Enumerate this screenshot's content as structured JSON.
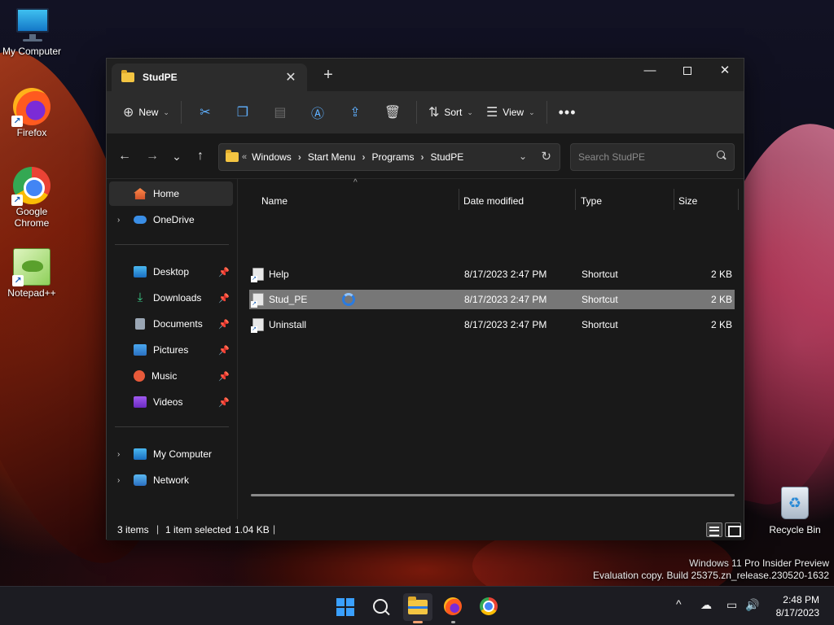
{
  "desktop": {
    "icons": [
      {
        "label": "My Computer",
        "icon": "monitor-icon"
      },
      {
        "label": "Firefox",
        "icon": "firefox-icon"
      },
      {
        "label": "Google Chrome",
        "icon": "chrome-icon"
      },
      {
        "label": "Notepad++",
        "icon": "notepadpp-icon"
      },
      {
        "label": "Recycle Bin",
        "icon": "recycle-bin-icon"
      }
    ],
    "watermark": {
      "line1": "Windows 11 Pro Insider Preview",
      "line2": "Evaluation copy. Build 25375.zn_release.230520-1632"
    }
  },
  "window": {
    "tab_title": "StudPE",
    "tab_close": "✕",
    "new_tab": "+",
    "controls": {
      "minimize": "—",
      "close": "✕"
    },
    "toolbar": {
      "new_label": "New",
      "sort_label": "Sort",
      "view_label": "View",
      "more": "•••",
      "icons": [
        "cut-icon",
        "copy-icon",
        "paste-icon",
        "rename-icon",
        "share-icon",
        "delete-icon"
      ]
    },
    "nav": {
      "back": "←",
      "forward": "→",
      "recent": "⌄",
      "up": "↑",
      "overflow": "«",
      "breadcrumbs": [
        "Windows",
        "Start Menu",
        "Programs",
        "StudPE"
      ],
      "search_placeholder": "Search StudPE"
    },
    "sidebar": {
      "items": [
        {
          "label": "Home",
          "icon": "home-icon",
          "selected": true
        },
        {
          "label": "OneDrive",
          "icon": "onedrive-icon",
          "expandable": true
        },
        {
          "label": "Desktop",
          "icon": "desktop-icon",
          "pinned": true
        },
        {
          "label": "Downloads",
          "icon": "downloads-icon",
          "pinned": true
        },
        {
          "label": "Documents",
          "icon": "documents-icon",
          "pinned": true
        },
        {
          "label": "Pictures",
          "icon": "pictures-icon",
          "pinned": true
        },
        {
          "label": "Music",
          "icon": "music-icon",
          "pinned": true
        },
        {
          "label": "Videos",
          "icon": "videos-icon",
          "pinned": true
        },
        {
          "label": "My Computer",
          "icon": "computer-icon",
          "expandable": true
        },
        {
          "label": "Network",
          "icon": "network-icon",
          "expandable": true
        }
      ]
    },
    "columns": {
      "name": "Name",
      "date": "Date modified",
      "type": "Type",
      "size": "Size"
    },
    "files": [
      {
        "name": "Help",
        "date": "8/17/2023 2:47 PM",
        "type": "Shortcut",
        "size": "2 KB",
        "selected": false
      },
      {
        "name": "Stud_PE",
        "date": "8/17/2023 2:47 PM",
        "type": "Shortcut",
        "size": "2 KB",
        "selected": true
      },
      {
        "name": "Uninstall",
        "date": "8/17/2023 2:47 PM",
        "type": "Shortcut",
        "size": "2 KB",
        "selected": false
      }
    ],
    "status": {
      "count": "3 items",
      "selection": "1 item selected",
      "size": "1.04 KB",
      "separator": "|"
    }
  },
  "taskbar": {
    "clock_time": "2:48 PM",
    "clock_date": "8/17/2023",
    "tray": {
      "chevron": "^"
    }
  },
  "colors": {
    "accent": "#2a7be0",
    "selection": "#777777",
    "window_bg": "#191919",
    "toolbar_bg": "#2c2c2c"
  }
}
